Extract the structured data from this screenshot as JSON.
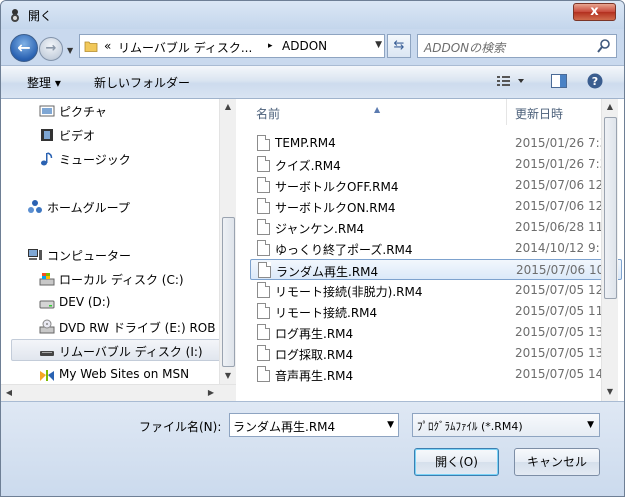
{
  "window": {
    "title": "開く",
    "close_label": "x"
  },
  "address": {
    "prefix": "«",
    "crumb1": "リムーバブル ディスク...",
    "separator": "▸",
    "crumb2": "ADDON"
  },
  "search": {
    "placeholder": "ADDONの検索"
  },
  "toolbar": {
    "organize_label": "整理 ▾",
    "new_folder_label": "新しいフォルダー"
  },
  "navpane": {
    "items": [
      {
        "label": "ピクチャ",
        "icon": "pictures-icon"
      },
      {
        "label": "ビデオ",
        "icon": "videos-icon"
      },
      {
        "label": "ミュージック",
        "icon": "music-icon"
      },
      {
        "label": "ホームグループ",
        "icon": "homegroup-icon"
      },
      {
        "label": "コンピューター",
        "icon": "computer-icon"
      },
      {
        "label": "ローカル ディスク (C:)",
        "icon": "local-disk-icon"
      },
      {
        "label": "DEV (D:)",
        "icon": "drive-icon"
      },
      {
        "label": "DVD RW ドライブ (E:) ROB",
        "icon": "dvd-drive-icon"
      },
      {
        "label": "リムーバブル ディスク (I:)",
        "icon": "removable-disk-icon"
      },
      {
        "label": "My Web Sites on MSN",
        "icon": "web-sites-icon"
      }
    ]
  },
  "filelist": {
    "col_name": "名前",
    "col_date": "更新日時",
    "rows": [
      {
        "name": "TEMP.RM4",
        "date": "2015/01/26 7:3"
      },
      {
        "name": "クイズ.RM4",
        "date": "2015/01/26 7:3"
      },
      {
        "name": "サーボトルクOFF.RM4",
        "date": "2015/07/06 12"
      },
      {
        "name": "サーボトルクON.RM4",
        "date": "2015/07/06 12"
      },
      {
        "name": "ジャンケン.RM4",
        "date": "2015/06/28 11"
      },
      {
        "name": "ゆっくり終了ポーズ.RM4",
        "date": "2014/10/12 9:"
      },
      {
        "name": "ランダム再生.RM4",
        "date": "2015/07/06 10"
      },
      {
        "name": "リモート接続(非脱力).RM4",
        "date": "2015/07/05 12"
      },
      {
        "name": "リモート接続.RM4",
        "date": "2015/07/05 11"
      },
      {
        "name": "ログ再生.RM4",
        "date": "2015/07/05 13"
      },
      {
        "name": "ログ採取.RM4",
        "date": "2015/07/05 13"
      },
      {
        "name": "音声再生.RM4",
        "date": "2015/07/05 14"
      }
    ],
    "selected_index": 6
  },
  "bottom": {
    "filename_label": "ファイル名(N):",
    "filename_value": "ランダム再生.RM4",
    "filetype_value": "ﾌﾟﾛｸﾞﾗﾑﾌｧｲﾙ (*.RM4)",
    "open_label": "開く(O)",
    "cancel_label": "キャンセル"
  },
  "colors": {
    "accent": "#2a62b2",
    "selection_border": "#7da2ce",
    "close": "#c7483a"
  }
}
